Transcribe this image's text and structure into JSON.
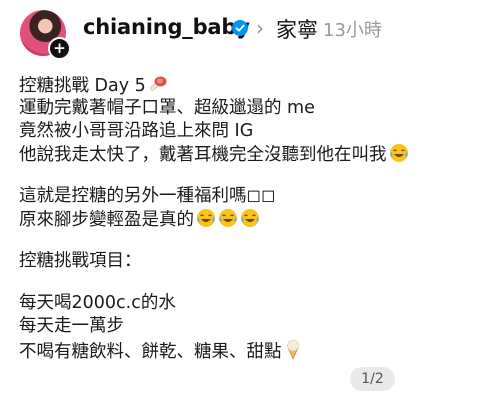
{
  "post": {
    "username": "chianing_baby",
    "music_label": "家寧",
    "time_ago": "13小時",
    "lines": [
      "控糖挑戰 Day 5",
      "運動完戴著帽子口罩、超級邋遢的 me",
      "竟然被小哥哥沿路追上來問 IG",
      "他說我走太快了，戴著耳機完全沒聽到他在叫我",
      "",
      "這就是控糖的另外一種福利嗎◻◻",
      "原來腳步變輕盈是真的",
      "",
      "控糖挑戰項目：",
      "",
      "每天喝2000c.c的水",
      "每天走一萬步",
      "不喝有糖飲料、餅乾、糖果、甜點"
    ],
    "pager": "1/2"
  },
  "icons": {
    "verified": "verified-badge-icon",
    "chevron": "chevron-right-icon",
    "emoji_day": "meat-on-bone-icon",
    "emoji_laugh": "tears-of-joy-icon",
    "emoji_icecream": "ice-cream-icon"
  },
  "colors": {
    "verified_blue": "#0095f6",
    "muted": "#8e8e8e"
  }
}
